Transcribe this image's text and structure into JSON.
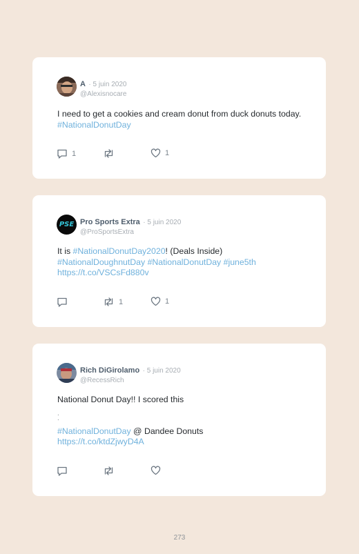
{
  "tweets": [
    {
      "name": "A",
      "date": "· 5 juin 2020",
      "handle": "@Alexisnocare",
      "text_plain": "I need to get a cookies and cream donut from duck donuts today. ",
      "text_link": "#NationalDonutDay",
      "replies": "1",
      "retweets": "",
      "likes": "1"
    },
    {
      "name": "Pro Sports Extra",
      "date": "· 5 juin 2020",
      "handle": "@ProSportsExtra",
      "avatar_text": "PSE",
      "line1_a": "It is ",
      "line1_link": "#NationalDonutDay2020",
      "line1_b": "! (Deals Inside)",
      "line2_link": "#NationalDoughnutDay #NationalDonutDay #june5th",
      "line3_link": "https://t.co/VSCsFd880v",
      "replies": "",
      "retweets": "1",
      "likes": "1"
    },
    {
      "name": "Rich DiGirolamo",
      "date": "· 5 juin 2020",
      "handle": "@RecessRich",
      "line1": "National Donut Day!! I scored this",
      "dot1": ".",
      "dot2": ".",
      "line4_link": "#NationalDonutDay",
      "line4_b": " @ Dandee Donuts",
      "line5_link": "https://t.co/ktdZjwyD4A",
      "replies": "",
      "retweets": "",
      "likes": ""
    }
  ],
  "page_number": "273",
  "icons": [
    "reply-icon",
    "retweet-icon",
    "like-icon"
  ],
  "colors": {
    "background": "#f3e7dc",
    "link": "#6fb1dc",
    "name": "#4e5d6c"
  }
}
